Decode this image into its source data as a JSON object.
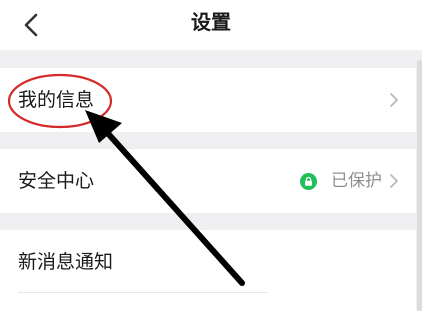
{
  "header": {
    "title": "设置"
  },
  "rows": [
    {
      "label": "我的信息"
    },
    {
      "label": "安全中心",
      "status": "已保护"
    },
    {
      "label": "新消息通知"
    }
  ],
  "colors": {
    "background": "#efeff2",
    "status_green": "#1fc05a",
    "annotation_red": "#d62a2a",
    "annotation_arrow": "#000000"
  },
  "icons": {
    "back": "chevron-left-icon",
    "row_arrow": "chevron-right-icon",
    "status": "lock-icon"
  }
}
